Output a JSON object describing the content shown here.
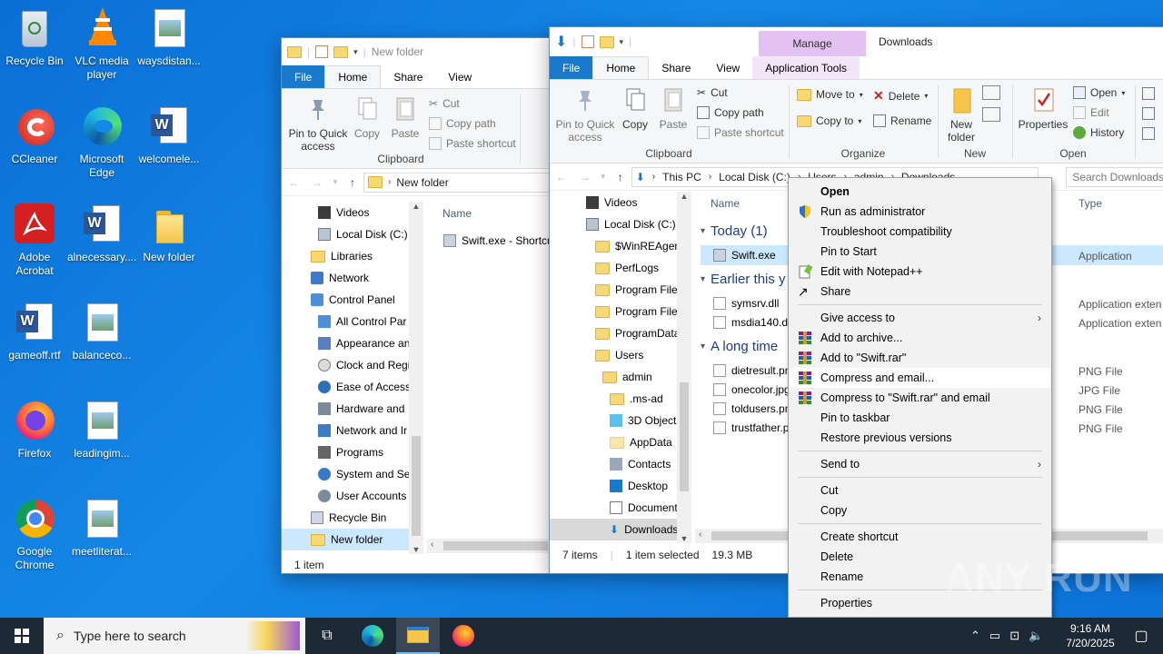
{
  "desktop": {
    "icons": [
      {
        "label": "Recycle Bin"
      },
      {
        "label": "VLC media player"
      },
      {
        "label": "waysdistan..."
      },
      {
        "label": "CCleaner"
      },
      {
        "label": "Microsoft Edge"
      },
      {
        "label": "welcomele..."
      },
      {
        "label": "Adobe Acrobat"
      },
      {
        "label": "alnecessary...."
      },
      {
        "label": "New folder"
      },
      {
        "label": "gameoff.rtf"
      },
      {
        "label": "balanceco..."
      },
      {
        "label": "Firefox"
      },
      {
        "label": "leadingim..."
      },
      {
        "label": "Google Chrome"
      },
      {
        "label": "meetliterat..."
      }
    ]
  },
  "win_left": {
    "title": "New folder",
    "tabs": {
      "file": "File",
      "home": "Home",
      "share": "Share",
      "view": "View"
    },
    "ribbon": {
      "pin": "Pin to Quick access",
      "copy": "Copy",
      "paste": "Paste",
      "cut": "Cut",
      "copy_path": "Copy path",
      "paste_shortcut": "Paste shortcut",
      "group_clipboard": "Clipboard"
    },
    "address": "New folder",
    "nav": [
      "Videos",
      "Local Disk (C:)",
      "Libraries",
      "Network",
      "Control Panel",
      "All Control Par",
      "Appearance an",
      "Clock and Regi",
      "Ease of Access",
      "Hardware and",
      "Network and Ir",
      "Programs",
      "System and Se",
      "User Accounts",
      "Recycle Bin",
      "New folder"
    ],
    "col_name": "Name",
    "files": [
      "Swift.exe - Shortcu"
    ],
    "status": "1 item"
  },
  "win_right": {
    "title": "Downloads",
    "manage": "Manage",
    "tabs": {
      "file": "File",
      "home": "Home",
      "share": "Share",
      "view": "View",
      "app_tools": "Application Tools"
    },
    "ribbon": {
      "pin": "Pin to Quick access",
      "copy": "Copy",
      "paste": "Paste",
      "cut": "Cut",
      "copy_path": "Copy path",
      "paste_shortcut": "Paste shortcut",
      "move_to": "Move to",
      "copy_to": "Copy to",
      "delete": "Delete",
      "rename": "Rename",
      "new_folder": "New folder",
      "properties": "Properties",
      "open": "Open",
      "edit": "Edit",
      "history": "History",
      "group_clipboard": "Clipboard",
      "group_organize": "Organize",
      "group_new": "New",
      "group_open": "Open"
    },
    "address": [
      "This PC",
      "Local Disk (C:)",
      "Users",
      "admin",
      "Downloads"
    ],
    "search_placeholder": "Search Downloads",
    "nav": [
      "Videos",
      "Local Disk (C:)",
      "$WinREAgent",
      "PerfLogs",
      "Program Files",
      "Program Files",
      "ProgramData",
      "Users",
      "admin",
      ".ms-ad",
      "3D Objects",
      "AppData",
      "Contacts",
      "Desktop",
      "Documents",
      "Downloads"
    ],
    "col_name": "Name",
    "col_type": "Type",
    "groups": [
      "Today (1)",
      "Earlier this y",
      "A long time"
    ],
    "files": [
      {
        "name": "Swift.exe",
        "type": "Application"
      },
      {
        "name": "symsrv.dll",
        "type": "Application exten"
      },
      {
        "name": "msdia140.dll",
        "type": "Application exten"
      },
      {
        "name": "dietresult.pn",
        "type": "PNG File"
      },
      {
        "name": "onecolor.jpg",
        "type": "JPG File"
      },
      {
        "name": "toldusers.pn",
        "type": "PNG File"
      },
      {
        "name": "trustfather.p",
        "type": "PNG File"
      }
    ],
    "status_items": "7 items",
    "status_selected": "1 item selected",
    "status_size": "19.3 MB"
  },
  "context_menu": {
    "open": "Open",
    "run_admin": "Run as administrator",
    "troubleshoot": "Troubleshoot compatibility",
    "pin_start": "Pin to Start",
    "edit_notepad": "Edit with Notepad++",
    "share": "Share",
    "give_access": "Give access to",
    "add_archive": "Add to archive...",
    "add_rar": "Add to \"Swift.rar\"",
    "compress_email": "Compress and email...",
    "compress_rar_email": "Compress to \"Swift.rar\" and email",
    "pin_taskbar": "Pin to taskbar",
    "restore": "Restore previous versions",
    "send_to": "Send to",
    "cut": "Cut",
    "copy": "Copy",
    "create_shortcut": "Create shortcut",
    "delete": "Delete",
    "rename": "Rename",
    "properties": "Properties"
  },
  "taskbar": {
    "search_placeholder": "Type here to search",
    "time": "9:16 AM",
    "date": "7/20/2025"
  },
  "watermark": "ANY RUN"
}
